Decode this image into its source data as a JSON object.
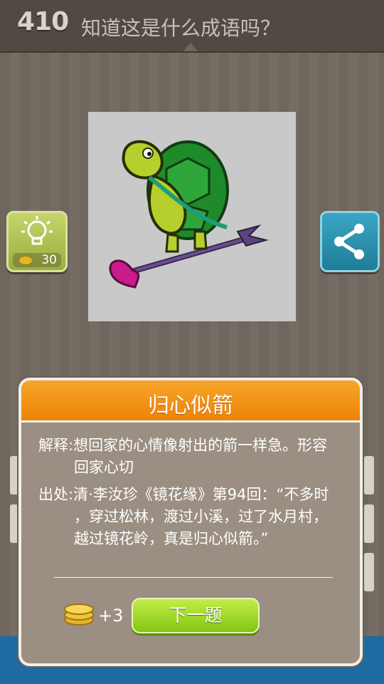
{
  "header": {
    "level": "410",
    "question": "知道这是什么成语吗？"
  },
  "hint": {
    "icon": "lightbulb-icon",
    "cost": "30"
  },
  "share": {
    "icon": "share-icon"
  },
  "modal": {
    "title": "归心似箭",
    "explain_label": "解释:",
    "explain_line1": "想回家的心情像射出的箭一样急。形容",
    "explain_line2": "回家心切",
    "source_label": "出处:",
    "source_line1": "清·李汝珍《镜花缘》第94回：“不多时",
    "source_line2": "，穿过松林，渡过小溪，过了水月村，",
    "source_line3": "越过镜花岭，真是归心似箭。”",
    "reward": "+3",
    "next_label": "下一题"
  },
  "colors": {
    "header_orange": "#ee8307",
    "next_green": "#84c60f",
    "hint_green": "#98ae3e",
    "share_blue": "#1f7d99"
  }
}
